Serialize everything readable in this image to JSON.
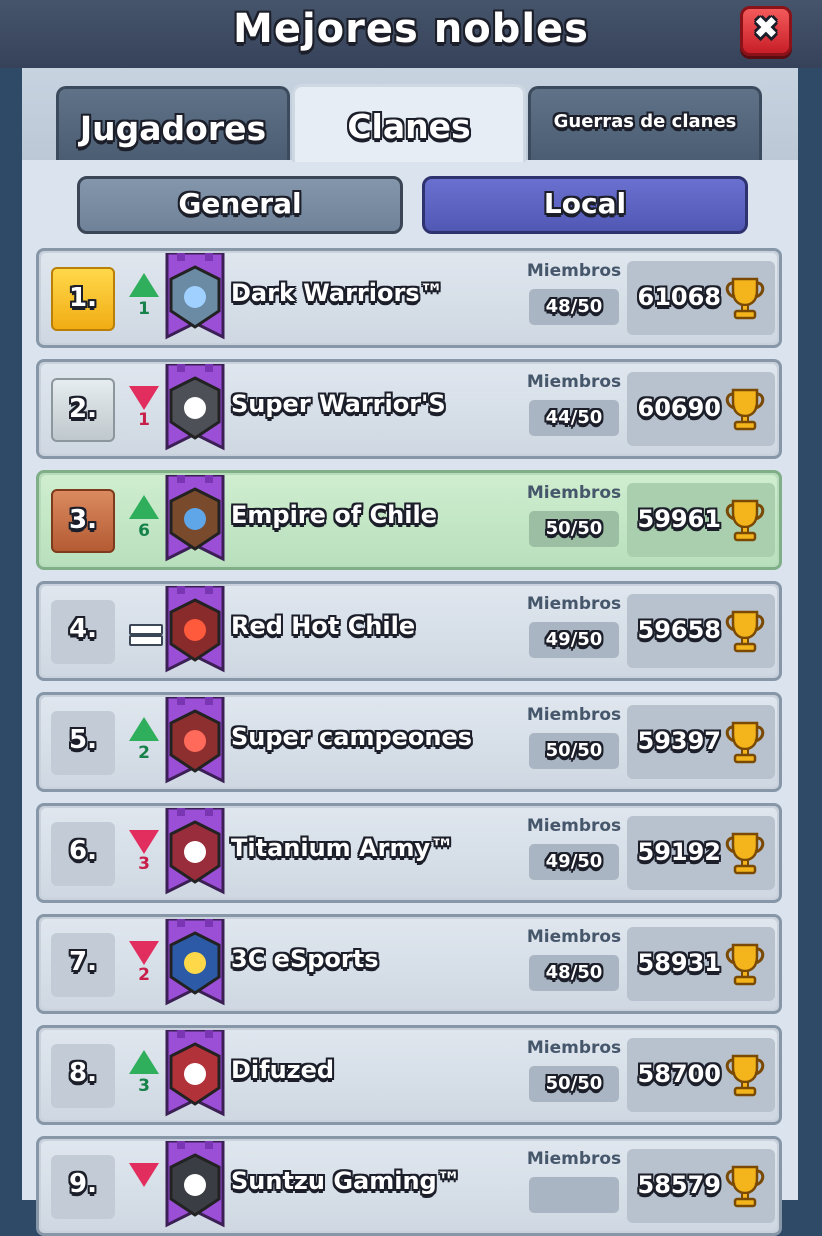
{
  "header": {
    "title": "Mejores nobles",
    "close_label": "✖"
  },
  "tabs": [
    {
      "label": "Jugadores",
      "active": false
    },
    {
      "label": "Clanes",
      "active": true
    },
    {
      "label": "Guerras de clanes",
      "active": false
    }
  ],
  "segments": [
    {
      "label": "General",
      "active": false
    },
    {
      "label": "Local",
      "active": true
    }
  ],
  "clans": [
    {
      "rank": "1.",
      "trend": "up",
      "change": "1",
      "name": "Dark Warriors™",
      "members_label": "Miembros",
      "members": "48/50",
      "trophies": "61068",
      "badge": "gold-tower"
    },
    {
      "rank": "2.",
      "trend": "down",
      "change": "1",
      "name": "Super Warrior'S",
      "members_label": "Miembros",
      "members": "44/50",
      "trophies": "60690",
      "badge": "skull"
    },
    {
      "rank": "3.",
      "trend": "up",
      "change": "6",
      "name": "Empire of Chile",
      "members_label": "Miembros",
      "members": "50/50",
      "trophies": "59961",
      "badge": "hammer"
    },
    {
      "rank": "4.",
      "trend": "same",
      "change": "",
      "name": "Red Hot Chile",
      "members_label": "Miembros",
      "members": "49/50",
      "trophies": "59658",
      "badge": "flame"
    },
    {
      "rank": "5.",
      "trend": "up",
      "change": "2",
      "name": "Super campeones",
      "members_label": "Miembros",
      "members": "50/50",
      "trophies": "59397",
      "badge": "arrow"
    },
    {
      "rank": "6.",
      "trend": "down",
      "change": "3",
      "name": "Titanium Army™",
      "members_label": "Miembros",
      "members": "49/50",
      "trophies": "59192",
      "badge": "lightning"
    },
    {
      "rank": "7.",
      "trend": "down",
      "change": "2",
      "name": "3C eSports",
      "members_label": "Miembros",
      "members": "48/50",
      "trophies": "58931",
      "badge": "star"
    },
    {
      "rank": "8.",
      "trend": "up",
      "change": "3",
      "name": "Difuzed",
      "members_label": "Miembros",
      "members": "50/50",
      "trophies": "58700",
      "badge": "yin-yang"
    },
    {
      "rank": "9.",
      "trend": "down",
      "change": "",
      "name": "Suntzu Gaming™",
      "members_label": "Miembros",
      "members": "",
      "trophies": "58579",
      "badge": "mask"
    }
  ],
  "colors": {
    "up": "#2fae5c",
    "down": "#e22e5e",
    "badge_purple": "#9b4fd6",
    "trophy": "#f3b51b"
  }
}
